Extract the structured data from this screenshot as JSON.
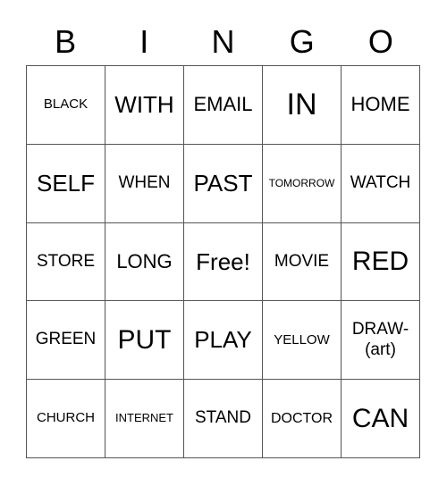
{
  "header": {
    "letters": [
      "B",
      "I",
      "N",
      "G",
      "O"
    ]
  },
  "cells": [
    [
      "BLACK",
      "WITH",
      "EMAIL",
      "IN",
      "HOME"
    ],
    [
      "SELF",
      "WHEN",
      "PAST",
      "TOMORROW",
      "WATCH"
    ],
    [
      "STORE",
      "LONG",
      "Free!",
      "MOVIE",
      "RED"
    ],
    [
      "GREEN",
      "PUT",
      "PLAY",
      "YELLOW",
      "DRAW-\n(art)"
    ],
    [
      "CHURCH",
      "INTERNET",
      "STAND",
      "DOCTOR",
      "CAN"
    ]
  ]
}
